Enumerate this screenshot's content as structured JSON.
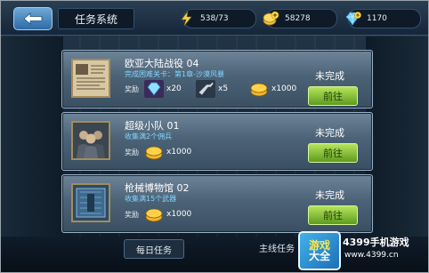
{
  "header": {
    "title": "任务系统",
    "back_icon": "back-arrow-icon",
    "resources": [
      {
        "icon": "energy-icon",
        "value": "538/73"
      },
      {
        "icon": "gold-coin-plus-icon",
        "value": "58278"
      },
      {
        "icon": "diamond-plus-icon",
        "value": "1170"
      }
    ]
  },
  "tasks": [
    {
      "name": "欧亚大陆战役 04",
      "desc": "完成困难关卡：第1章-沙漠风暴",
      "reward_label": "奖励",
      "rewards": [
        {
          "icon": "diamond-icon",
          "value": "x20"
        },
        {
          "icon": "weapon-part-icon",
          "value": "x5"
        },
        {
          "icon": "gold-icon",
          "value": "x1000"
        }
      ],
      "status": "未完成",
      "button": "前往",
      "thumb_icon": "document-icon"
    },
    {
      "name": "超级小队 01",
      "desc": "收集满2个佣兵",
      "reward_label": "奖励",
      "rewards": [
        {
          "icon": "gold-icon",
          "value": "x1000"
        }
      ],
      "status": "未完成",
      "button": "前往",
      "thumb_icon": "squad-icon"
    },
    {
      "name": "枪械博物馆 02",
      "desc": "收集满15个武器",
      "reward_label": "奖励",
      "rewards": [
        {
          "icon": "gold-icon",
          "value": "x1000"
        }
      ],
      "status": "未完成",
      "button": "前往",
      "thumb_icon": "vault-icon"
    }
  ],
  "footer": {
    "daily_tab": "每日任务",
    "main_tab": "主线任务",
    "logo_line1": "游戏",
    "logo_line2": "大全",
    "brand": "4399手机游戏",
    "brand_url": "www.4399.cn"
  },
  "colors": {
    "go_button": "#7fc23a",
    "desc_text": "#7fd6ff",
    "panel": "#5a7185"
  }
}
